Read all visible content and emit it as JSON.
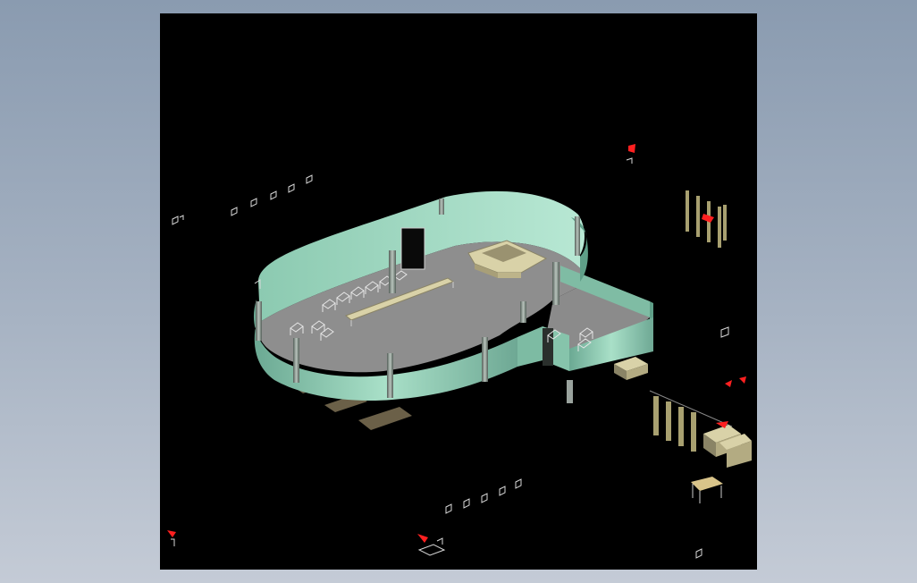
{
  "viewport": {
    "background": "#000000",
    "page_background": "#9aa8ba",
    "render_mode": "3d-shaded-isometric"
  },
  "model": {
    "wall_color": "#8fcdb4",
    "wall_shade": "#5f9f88",
    "floor_color": "#8e8e8e",
    "column_color": "#7f8b84",
    "furniture_color": "#d9d2a8",
    "block_color": "#7c7058",
    "marker_color": "#ff2020",
    "stray_stroke": "#d8d8d8"
  },
  "objects": [
    "outer-curved-wall",
    "annex-room",
    "floor-slab",
    "reception-counter",
    "conference-table",
    "chair-group",
    "column",
    "foundation-block",
    "stacked-boxes",
    "small-table",
    "camera-marker",
    "light-fixture"
  ]
}
